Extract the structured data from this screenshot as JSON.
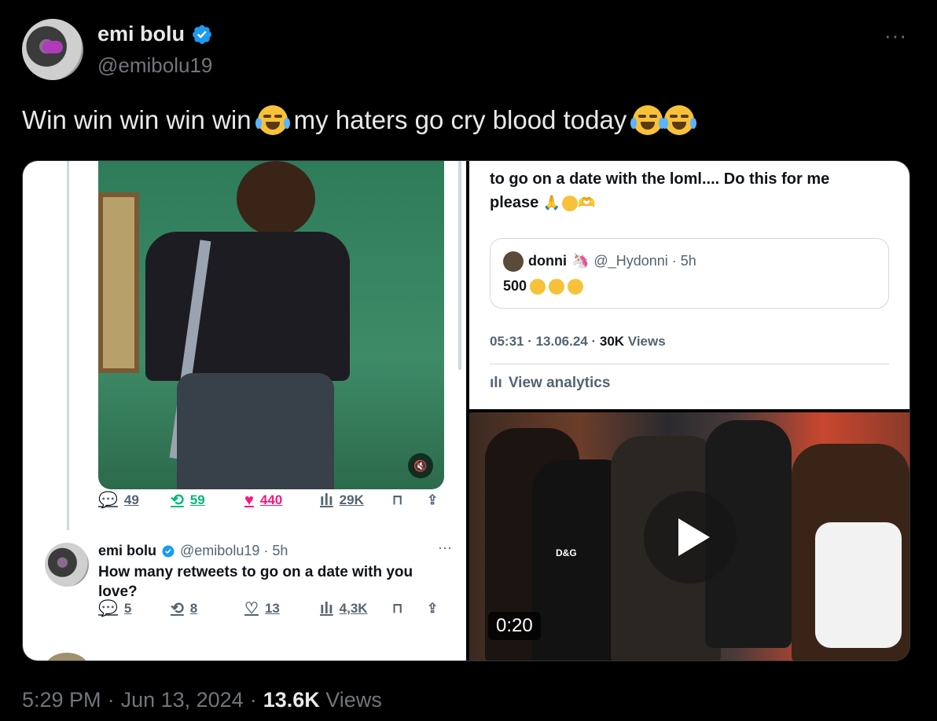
{
  "author": {
    "display_name": "emi bolu",
    "handle": "@emibolu19",
    "verified_icon": "verified-badge-icon",
    "more_label": "···"
  },
  "tweet": {
    "text_part1": "Win win win win win",
    "text_part2": "my haters go cry blood today",
    "emoji": "face-with-tears-of-joy"
  },
  "embedded_left": {
    "metrics": {
      "replies": "49",
      "retweets": "59",
      "likes": "440",
      "views": "29K"
    },
    "reply": {
      "name": "emi bolu",
      "handle_time": "@emibolu19 · 5h",
      "text": "How many retweets to go on a date with you love?",
      "metrics": {
        "replies": "5",
        "retweets": "8",
        "likes": "13",
        "views": "4,3K"
      }
    }
  },
  "embedded_right": {
    "text_line1": "to go on a date with the loml.... Do this for me",
    "text_line2": "please",
    "quote": {
      "name": "donni",
      "handle_time": "@_Hydonni · 5h",
      "text": "500"
    },
    "meta_prefix": "05:31 · 13.06.24 · ",
    "meta_views_count": "30K",
    "meta_views_label": " Views",
    "analytics_label": "View analytics"
  },
  "video": {
    "duration": "0:20",
    "shirt_text": "D&G"
  },
  "footer": {
    "time": "5:29 PM",
    "sep1": "·",
    "date": "Jun 13, 2024",
    "sep2": "·",
    "views_count": "13.6K",
    "views_label": "Views"
  },
  "colors": {
    "background": "#000000",
    "text_primary": "#e7e9ea",
    "text_secondary": "#71767b",
    "verified_blue": "#1d9bf0",
    "like_pink": "#f91880",
    "retweet_green": "#00ba7c"
  }
}
